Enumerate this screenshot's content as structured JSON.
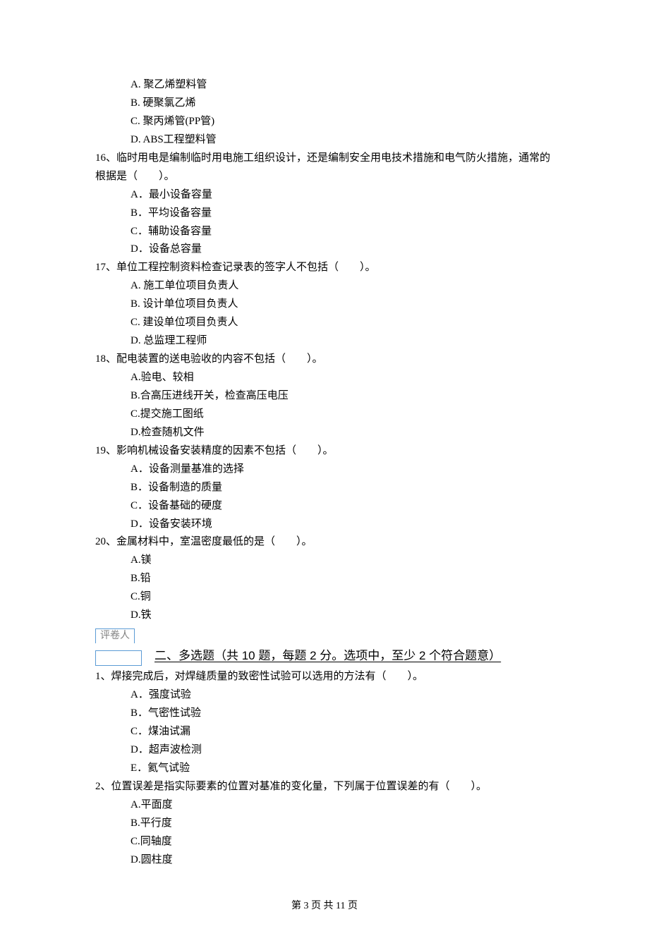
{
  "q15": {
    "optA": "A.  聚乙烯塑料管",
    "optB": "B.  硬聚氯乙烯",
    "optC": "C.  聚丙烯管(PP管)",
    "optD": "D.  ABS工程塑料管"
  },
  "q16": {
    "stem": "16、临时用电是编制临时用电施工组织设计，还是编制安全用电技术措施和电气防火措施，通常的根据是（　　）。",
    "optA": "A．最小设备容量",
    "optB": "B．平均设备容量",
    "optC": "C．辅助设备容量",
    "optD": "D．设备总容量"
  },
  "q17": {
    "stem": "17、单位工程控制资料检查记录表的签字人不包括（　　）。",
    "optA": "A.  施工单位项目负责人",
    "optB": "B.  设计单位项目负责人",
    "optC": "C.  建设单位项目负责人",
    "optD": "D.  总监理工程师"
  },
  "q18": {
    "stem": "18、配电装置的送电验收的内容不包括（　　）。",
    "optA": "A.验电、较相",
    "optB": "B.合高压进线开关，检查高压电压",
    "optC": "C.提交施工图纸",
    "optD": "D.检查随机文件"
  },
  "q19": {
    "stem": "19、影响机械设备安装精度的因素不包括（　　）。",
    "optA": "A．设备测量基准的选择",
    "optB": "B．设备制造的质量",
    "optC": "C．设备基础的硬度",
    "optD": "D．设备安装环境"
  },
  "q20": {
    "stem": "20、金属材料中，室温密度最低的是（　　）。",
    "optA": "A.镁",
    "optB": "B.铅",
    "optC": "C.铜",
    "optD": "D.铁"
  },
  "graderLabel": "评卷人",
  "sectionTitle": "二、多选题（共 10 题，每题 2 分。选项中，至少 2 个符合题意）",
  "mcq1": {
    "stem": "1、焊接完成后，对焊缝质量的致密性试验可以选用的方法有（　　）。",
    "optA": "A．强度试验",
    "optB": "B．气密性试验",
    "optC": "C．煤油试漏",
    "optD": "D．超声波检测",
    "optE": "E．氦气试验"
  },
  "mcq2": {
    "stem": "2、位置误差是指实际要素的位置对基准的变化量，下列属于位置误差的有（　　）。",
    "optA": "A.平面度",
    "optB": "B.平行度",
    "optC": "C.同轴度",
    "optD": "D.圆柱度"
  },
  "footer": "第 3 页 共 11 页"
}
